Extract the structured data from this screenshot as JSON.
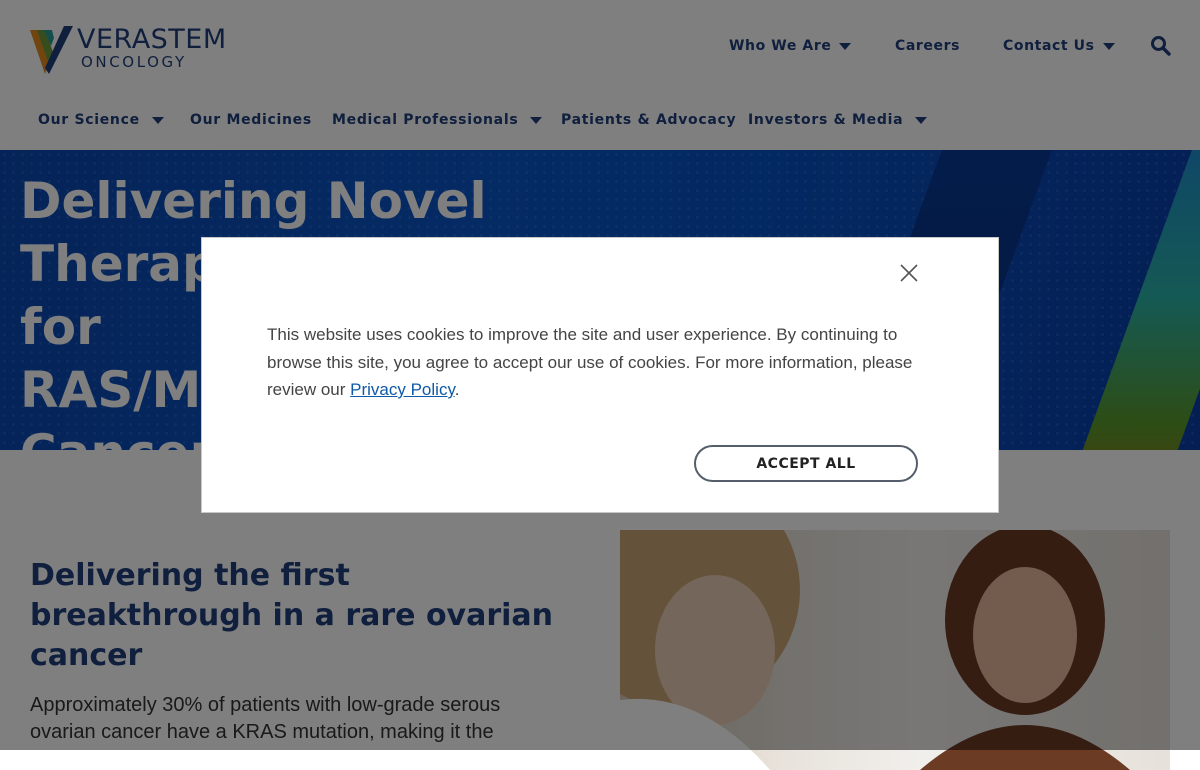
{
  "brand": {
    "name": "VERASTEM",
    "sub": "ONCOLOGY"
  },
  "utility_nav": [
    {
      "label": "Who We Are",
      "dropdown": true
    },
    {
      "label": "Careers",
      "dropdown": false
    },
    {
      "label": "Contact Us",
      "dropdown": true
    }
  ],
  "main_nav": [
    {
      "label": "Our Science",
      "dropdown": true
    },
    {
      "label": "Our Medicines",
      "dropdown": false
    },
    {
      "label": "Medical Professionals",
      "dropdown": true
    },
    {
      "label": "Patients & Advocacy",
      "dropdown": false
    },
    {
      "label": "Investors & Media",
      "dropdown": true
    }
  ],
  "icons": {
    "search": "search-icon",
    "close": "close-icon",
    "caret": "caret-down-icon"
  },
  "hero": {
    "title_lines": [
      "Delivering Novel Therapies",
      "for",
      "RAS/MAPK-Driven",
      "Cancers"
    ]
  },
  "content": {
    "title": "Delivering the first breakthrough in a rare ovarian cancer",
    "body": "Approximately 30% of patients with low-grade serous ovarian cancer have a KRAS mutation, making it the"
  },
  "cookie_modal": {
    "text": "This website uses cookies to improve the site and user experience. By continuing to browse this site, you agree to accept our use of cookies. For more information, please review our ",
    "link_label": "Privacy Policy",
    "text_end": ".",
    "accept_label": "ACCEPT ALL"
  },
  "colors": {
    "brand_navy": "#1e3f7a",
    "hero_blue": "#0a4fc0",
    "link_blue": "#0e59a8",
    "overlay": "rgba(0,0,0,0.5)"
  }
}
